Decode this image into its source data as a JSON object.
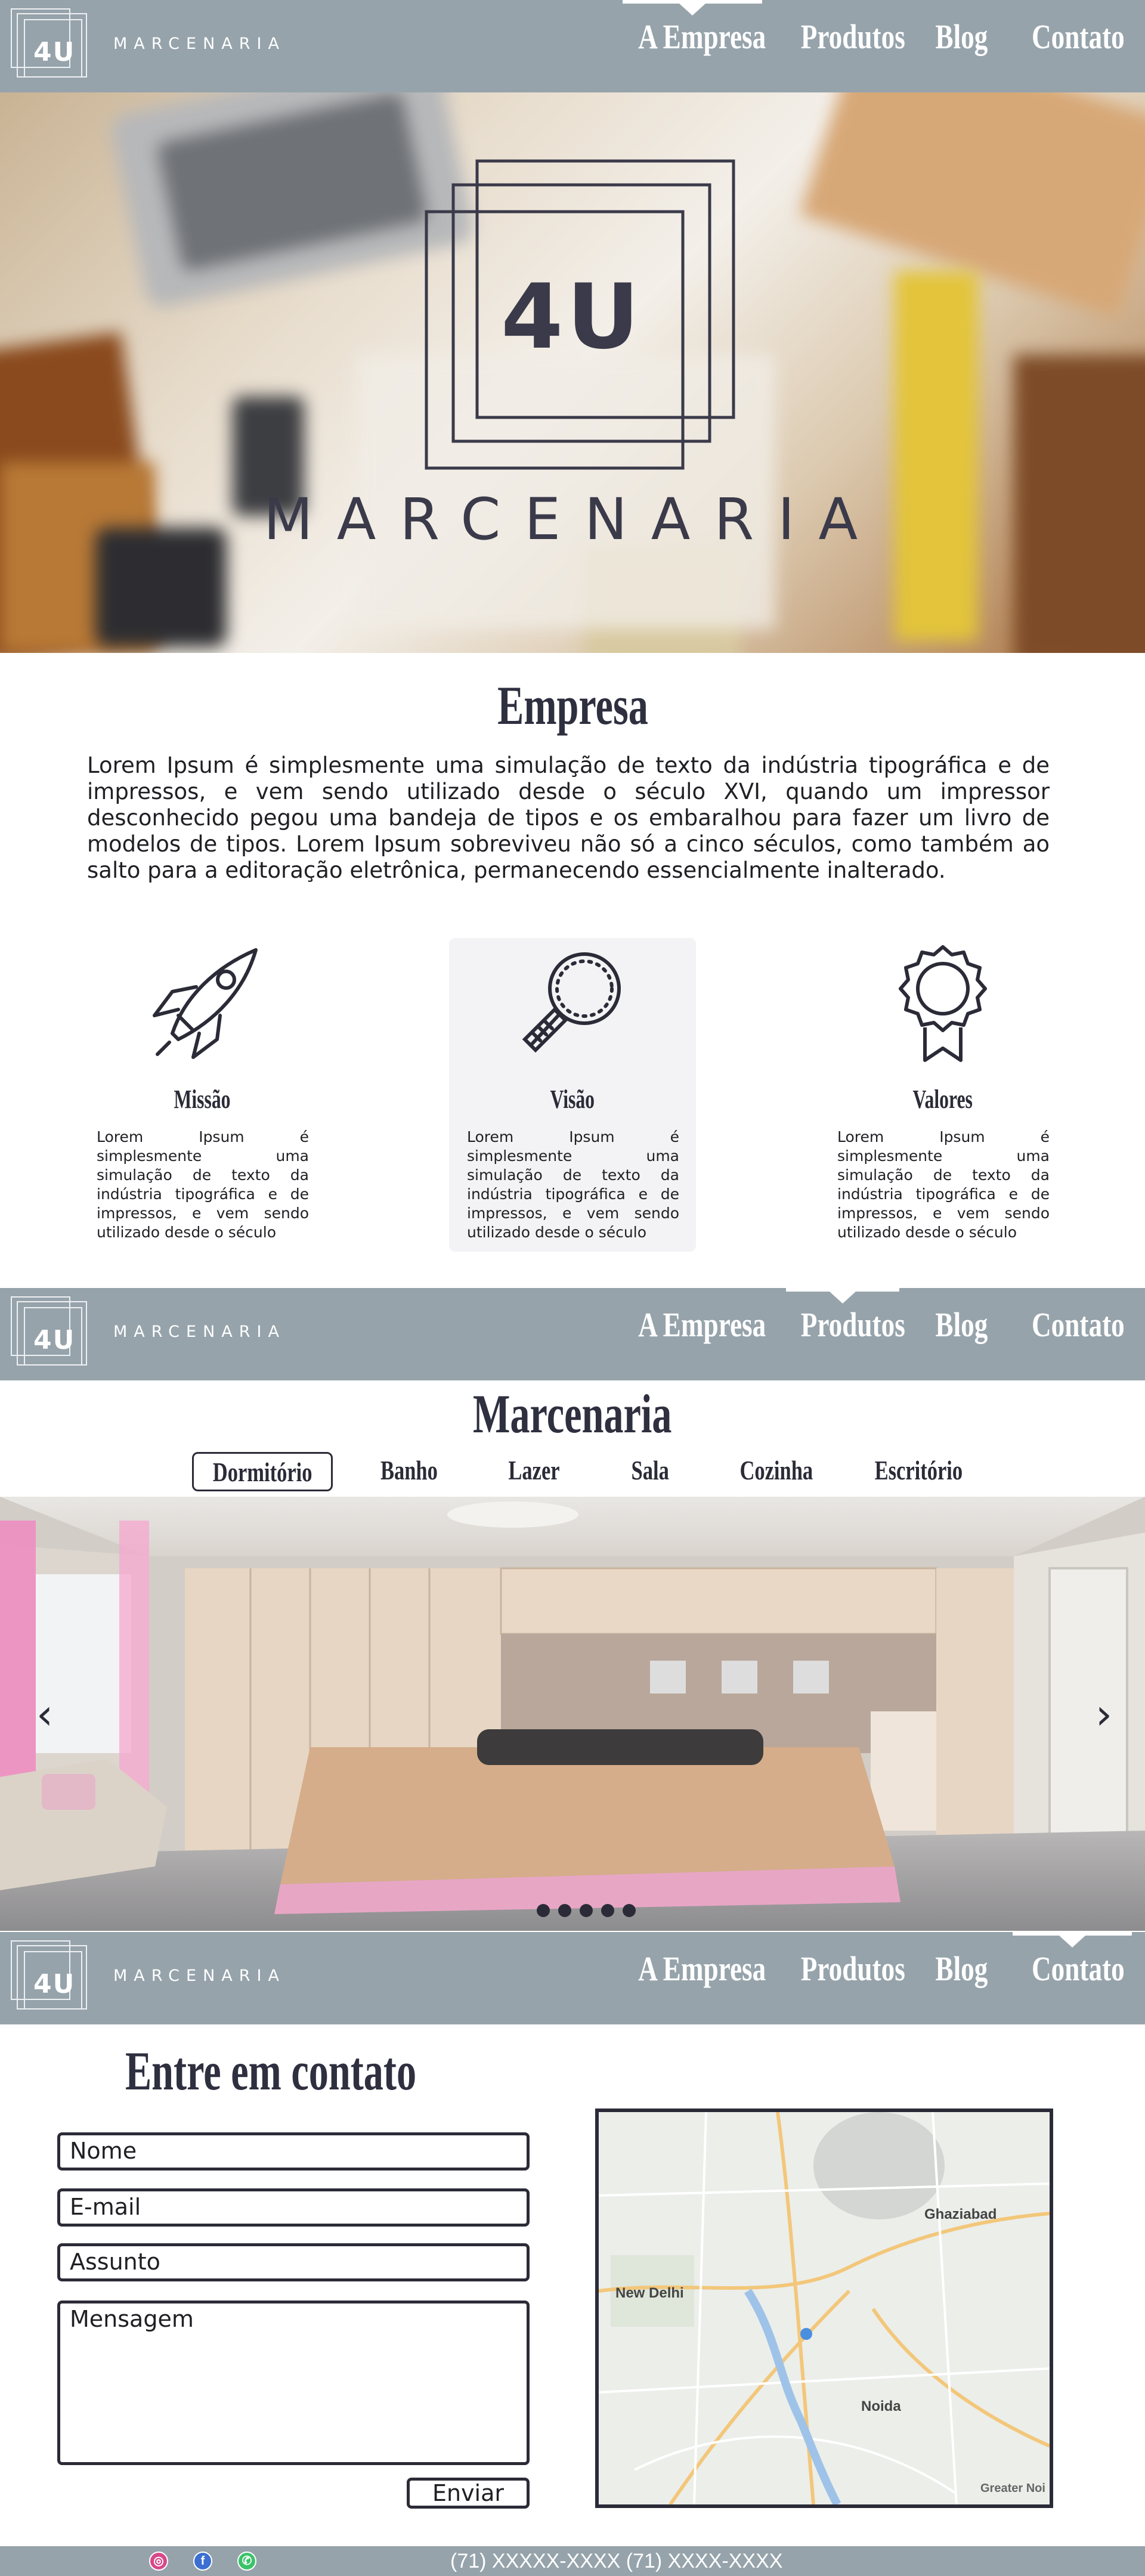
{
  "brand": {
    "logo_text": "4U",
    "name": "MARCENARIA"
  },
  "nav": {
    "items": [
      {
        "label": "A Empresa"
      },
      {
        "label": "Produtos"
      },
      {
        "label": "Blog"
      },
      {
        "label": "Contato"
      }
    ]
  },
  "about": {
    "title": "Empresa",
    "text": "Lorem Ipsum é simplesmente uma simulação de texto da indústria tipográfica e de impressos, e vem sendo utilizado desde o século XVI, quando um impressor desconhecido pegou uma bandeja de tipos e os embaralhou para fazer um livro de modelos de tipos. Lorem Ipsum sobreviveu não só a cinco séculos, como também ao salto para a editoração eletrônica, permanecendo essencialmente inalterado.",
    "cards": [
      {
        "icon": "rocket-icon",
        "title": "Missão",
        "text": "Lorem Ipsum é simplesmente uma simulação de texto da indústria tipográfica e de impressos, e vem sendo utilizado desde o século"
      },
      {
        "icon": "magnifier-icon",
        "title": "Visão",
        "text": "Lorem Ipsum é simplesmente uma simulação de texto da indústria tipográfica e de impressos, e vem sendo utilizado desde o século"
      },
      {
        "icon": "award-badge-icon",
        "title": "Valores",
        "text": "Lorem Ipsum é simplesmente uma simulação de texto da indústria tipográfica e de impressos, e vem sendo utilizado desde o século"
      }
    ]
  },
  "products": {
    "title": "Marcenaria",
    "tabs": [
      "Dormitório",
      "Banho",
      "Lazer",
      "Sala",
      "Cozinha",
      "Escritório"
    ],
    "active_tab": "Dormitório",
    "prev_glyph": "‹",
    "next_glyph": "›",
    "slide_count": 5
  },
  "contact": {
    "title": "Entre em contato",
    "fields": {
      "name": "Nome",
      "email": "E-mail",
      "subject": "Assunto",
      "message": "Mensagem"
    },
    "send_label": "Enviar",
    "map_labels": [
      "Ghaziabad",
      "New Delhi",
      "Noida",
      "Greater Noi"
    ]
  },
  "footer": {
    "phones": "(71) XXXXX-XXXX   (71) XXXX-XXXX",
    "social": [
      {
        "icon": "instagram-icon",
        "glyph": "◎"
      },
      {
        "icon": "facebook-icon",
        "glyph": "f"
      },
      {
        "icon": "whatsapp-icon",
        "glyph": "✆"
      }
    ]
  },
  "colors": {
    "navbar": "#96a3ab",
    "text_dark": "#2b2b38",
    "card_active": "#f3f3f5"
  }
}
